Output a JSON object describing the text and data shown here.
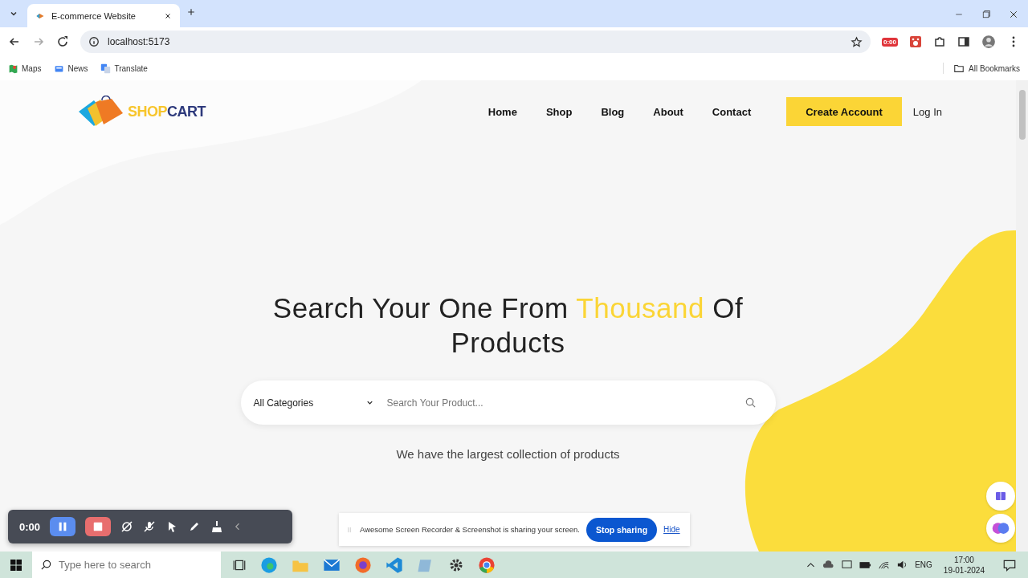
{
  "browser": {
    "tab_title": "E-commerce Website",
    "address": "localhost:5173",
    "bookmarks": [
      {
        "label": "Maps"
      },
      {
        "label": "News"
      },
      {
        "label": "Translate"
      }
    ],
    "all_bookmarks": "All Bookmarks",
    "extension_badge": "0:00"
  },
  "nav": {
    "logo": {
      "first": "SHOP",
      "second": "CART"
    },
    "links": [
      {
        "label": "Home"
      },
      {
        "label": "Shop"
      },
      {
        "label": "Blog"
      },
      {
        "label": "About"
      },
      {
        "label": "Contact"
      }
    ],
    "create_account": "Create Account",
    "login": "Log In"
  },
  "hero": {
    "heading": "Search Your One From **Thousand** Of Products",
    "category": "All Categories",
    "search_placeholder": "Search Your Product...",
    "subtitle": "We have the largest collection of products"
  },
  "recorder": {
    "time": "0:00"
  },
  "share_bar": {
    "message": "Awesome Screen Recorder & Screenshot is sharing your screen.",
    "stop": "Stop sharing",
    "hide": "Hide"
  },
  "taskbar": {
    "search_placeholder": "Type here to search",
    "language": "ENG",
    "time": "17:00",
    "date": "19-01-2024"
  }
}
